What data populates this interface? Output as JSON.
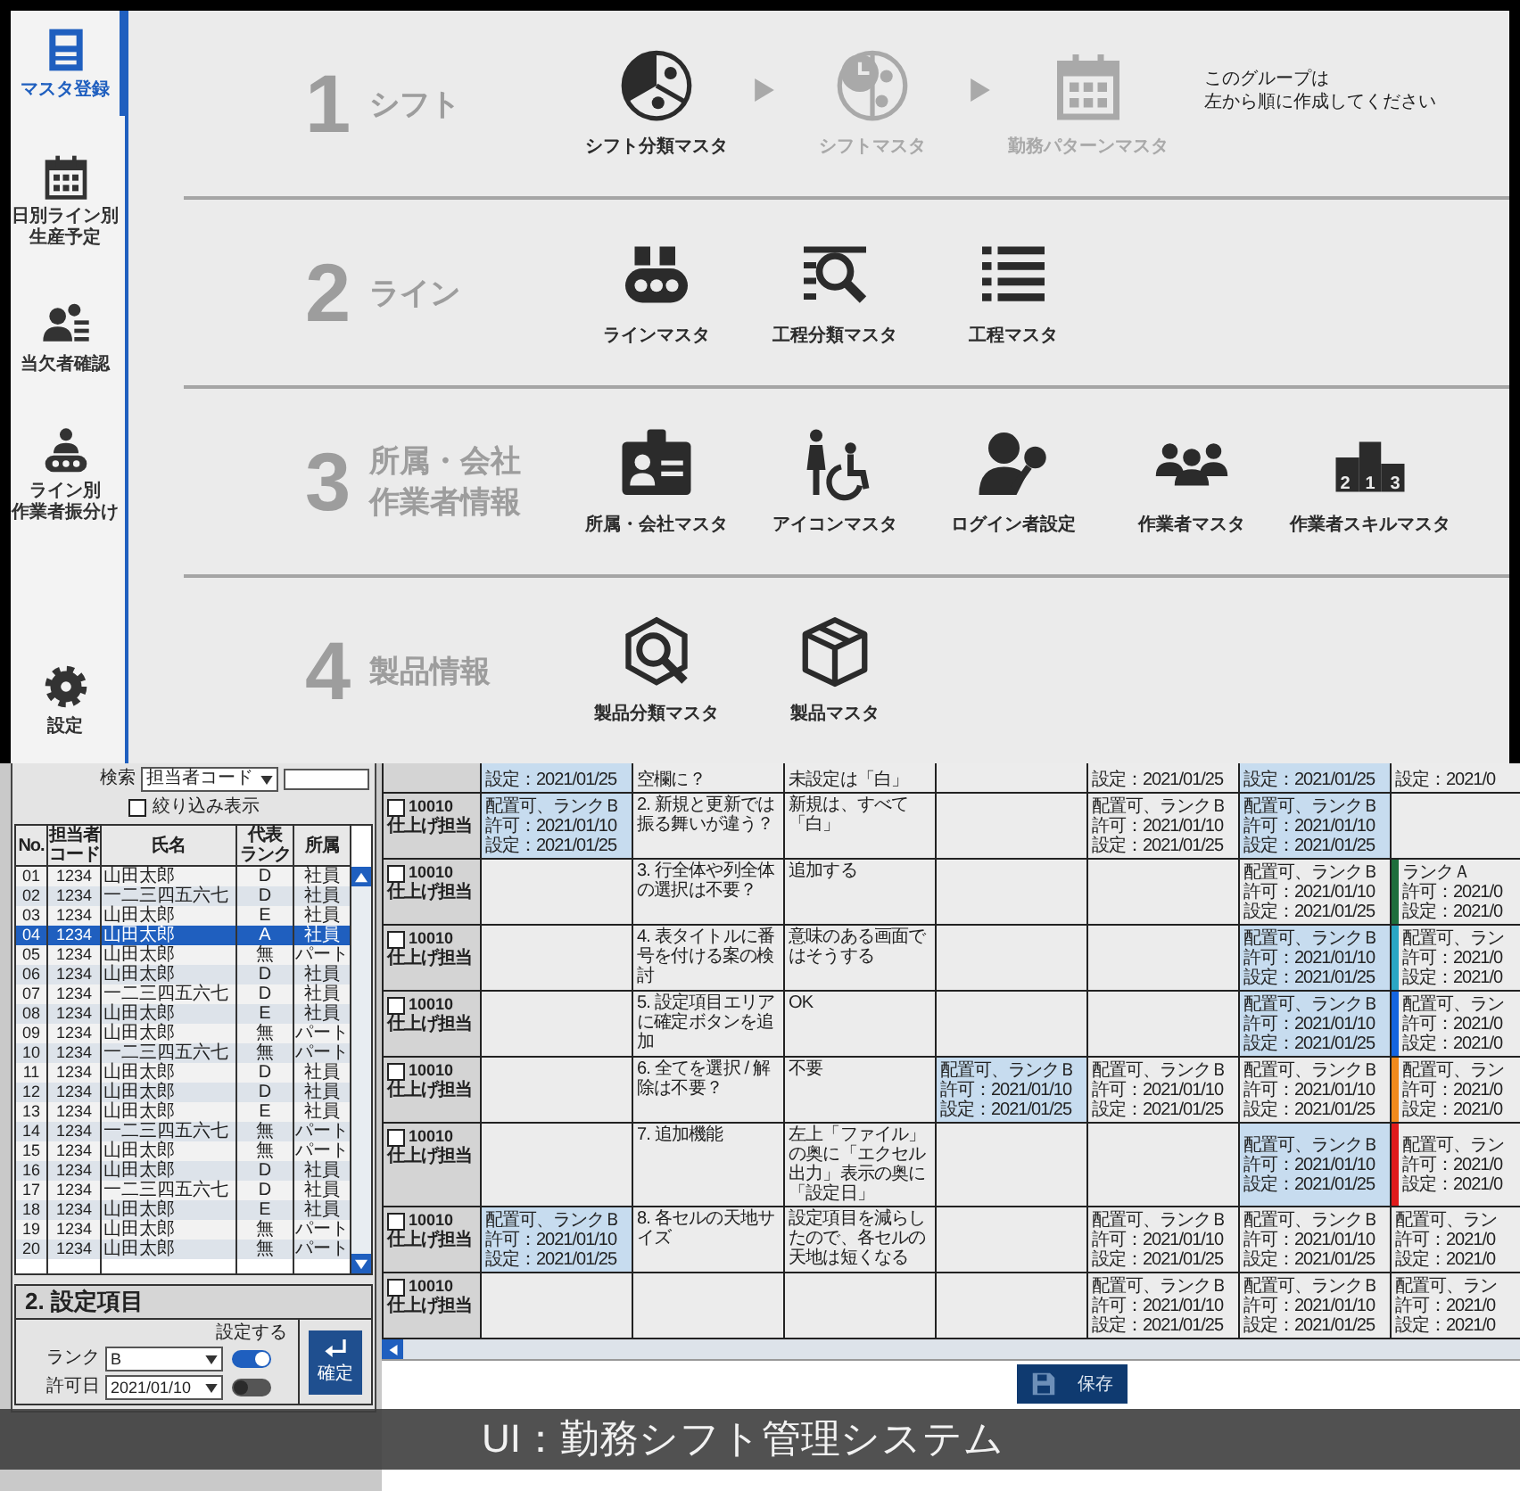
{
  "sidebar": {
    "items": [
      {
        "lines": [
          "マスタ登録"
        ],
        "selected": true
      },
      {
        "lines": [
          "日別ライン別",
          "生産予定"
        ],
        "selected": false
      },
      {
        "lines": [
          "当欠者確認"
        ],
        "selected": false
      },
      {
        "lines": [
          "ライン別",
          "作業者振分け"
        ],
        "selected": false
      },
      {
        "lines": [
          "設定"
        ],
        "selected": false
      }
    ]
  },
  "sections": [
    {
      "number": "1",
      "title": [
        "シフト"
      ],
      "items": [
        {
          "kind": "item",
          "label": "シフト分類マスタ",
          "disabled": false
        },
        {
          "kind": "arrow"
        },
        {
          "kind": "item",
          "label": "シフトマスタ",
          "disabled": true
        },
        {
          "kind": "arrow"
        },
        {
          "kind": "item",
          "label": "勤務パターンマスタ",
          "disabled": true
        }
      ],
      "note": [
        "このグループは",
        "左から順に作成してください"
      ]
    },
    {
      "number": "2",
      "title": [
        "ライン"
      ],
      "items": [
        {
          "kind": "item",
          "label": "ラインマスタ",
          "disabled": false
        },
        {
          "kind": "item",
          "label": "工程分類マスタ",
          "disabled": false
        },
        {
          "kind": "item",
          "label": "工程マスタ",
          "disabled": false
        }
      ]
    },
    {
      "number": "3",
      "title": [
        "所属・会社",
        "作業者情報"
      ],
      "items": [
        {
          "kind": "item",
          "label": "所属・会社マスタ",
          "disabled": false
        },
        {
          "kind": "item",
          "label": "アイコンマスタ",
          "disabled": false
        },
        {
          "kind": "item",
          "label": "ログイン者設定",
          "disabled": false
        },
        {
          "kind": "item",
          "label": "作業者マスタ",
          "disabled": false
        },
        {
          "kind": "item",
          "label": "作業者スキルマスタ",
          "icon_text": [
            "2",
            "1",
            "3"
          ],
          "disabled": false
        }
      ]
    },
    {
      "number": "4",
      "title": [
        "製品情報"
      ],
      "items": [
        {
          "kind": "item",
          "label": "製品分類マスタ",
          "disabled": false
        },
        {
          "kind": "item",
          "label": "製品マスタ",
          "disabled": false
        }
      ]
    }
  ],
  "staff_panel": {
    "search": {
      "label": "検索",
      "select": "担当者コード"
    },
    "filter": {
      "label": "絞り込み表示",
      "checked": false
    },
    "columns": [
      [
        "No."
      ],
      [
        "担当者",
        "コード"
      ],
      [
        "氏名"
      ],
      [
        "代表",
        "ランク"
      ],
      [
        "所属"
      ]
    ],
    "rows": [
      {
        "no": "01",
        "code": "1234",
        "name": "山田太郎",
        "rank": "D",
        "dept": "社員",
        "selected": false
      },
      {
        "no": "02",
        "code": "1234",
        "name": "一二三四五六七",
        "rank": "D",
        "dept": "社員",
        "selected": false
      },
      {
        "no": "03",
        "code": "1234",
        "name": "山田太郎",
        "rank": "E",
        "dept": "社員",
        "selected": false
      },
      {
        "no": "04",
        "code": "1234",
        "name": "山田太郎",
        "rank": "A",
        "dept": "社員",
        "selected": true
      },
      {
        "no": "05",
        "code": "1234",
        "name": "山田太郎",
        "rank": "無",
        "dept": "パート",
        "selected": false
      },
      {
        "no": "06",
        "code": "1234",
        "name": "山田太郎",
        "rank": "D",
        "dept": "社員",
        "selected": false
      },
      {
        "no": "07",
        "code": "1234",
        "name": "一二三四五六七",
        "rank": "D",
        "dept": "社員",
        "selected": false
      },
      {
        "no": "08",
        "code": "1234",
        "name": "山田太郎",
        "rank": "E",
        "dept": "社員",
        "selected": false
      },
      {
        "no": "09",
        "code": "1234",
        "name": "山田太郎",
        "rank": "無",
        "dept": "パート",
        "selected": false
      },
      {
        "no": "10",
        "code": "1234",
        "name": "一二三四五六七",
        "rank": "無",
        "dept": "パート",
        "selected": false
      },
      {
        "no": "11",
        "code": "1234",
        "name": "山田太郎",
        "rank": "D",
        "dept": "社員",
        "selected": false
      },
      {
        "no": "12",
        "code": "1234",
        "name": "山田太郎",
        "rank": "D",
        "dept": "社員",
        "selected": false
      },
      {
        "no": "13",
        "code": "1234",
        "name": "山田太郎",
        "rank": "E",
        "dept": "社員",
        "selected": false
      },
      {
        "no": "14",
        "code": "1234",
        "name": "一二三四五六七",
        "rank": "無",
        "dept": "パート",
        "selected": false
      },
      {
        "no": "15",
        "code": "1234",
        "name": "山田太郎",
        "rank": "無",
        "dept": "パート",
        "selected": false
      },
      {
        "no": "16",
        "code": "1234",
        "name": "山田太郎",
        "rank": "D",
        "dept": "社員",
        "selected": false
      },
      {
        "no": "17",
        "code": "1234",
        "name": "一二三四五六七",
        "rank": "D",
        "dept": "社員",
        "selected": false
      },
      {
        "no": "18",
        "code": "1234",
        "name": "山田太郎",
        "rank": "E",
        "dept": "社員",
        "selected": false
      },
      {
        "no": "19",
        "code": "1234",
        "name": "山田太郎",
        "rank": "無",
        "dept": "パート",
        "selected": false
      },
      {
        "no": "20",
        "code": "1234",
        "name": "山田太郎",
        "rank": "無",
        "dept": "パート",
        "selected": false
      }
    ],
    "settings": {
      "title": "2. 設定項目",
      "toggle_label": "設定する",
      "fields": [
        {
          "label": "ランク",
          "value": "B",
          "on": true
        },
        {
          "label": "許可日",
          "value": "2021/01/10",
          "on": false
        }
      ],
      "button": "確定"
    }
  },
  "grid": {
    "rows": [
      {
        "cells": [
          {
            "kind": "assignment",
            "lines": [
              "設定：2021/01/25"
            ],
            "highlighted": true
          },
          {
            "kind": "note",
            "text": "空欄に？"
          },
          {
            "kind": "note",
            "text": "未設定は「白」"
          },
          {
            "kind": "empty"
          },
          {
            "kind": "assignment",
            "lines": [
              "設定：2021/01/25"
            ],
            "highlighted": false
          },
          {
            "kind": "assignment",
            "lines": [
              "設定：2021/01/25"
            ],
            "highlighted": true
          },
          {
            "kind": "assignment",
            "lines": [
              "設定：2021/0"
            ],
            "highlighted": false
          }
        ]
      },
      {
        "header": {
          "code": "10010",
          "role": "仕上げ担当",
          "checked": false
        },
        "cells": [
          {
            "kind": "assignment",
            "lines": [
              "配置可、ランクＢ",
              "許可：2021/01/10",
              "設定：2021/01/25"
            ],
            "highlighted": true
          },
          {
            "kind": "note",
            "text": "2. 新規と更新では振る舞いが違う？"
          },
          {
            "kind": "note",
            "text": "新規は、すべて「白」"
          },
          {
            "kind": "empty"
          },
          {
            "kind": "assignment",
            "lines": [
              "配置可、ランクＢ",
              "許可：2021/01/10",
              "設定：2021/01/25"
            ],
            "highlighted": false
          },
          {
            "kind": "assignment",
            "lines": [
              "配置可、ランクＢ",
              "許可：2021/01/10",
              "設定：2021/01/25"
            ],
            "highlighted": true
          },
          {
            "kind": "empty"
          }
        ]
      },
      {
        "header": {
          "code": "10010",
          "role": "仕上げ担当",
          "checked": false
        },
        "cells": [
          {
            "kind": "empty"
          },
          {
            "kind": "note",
            "text": "3. 行全体や列全体の選択は不要？"
          },
          {
            "kind": "note",
            "text": "追加する"
          },
          {
            "kind": "empty"
          },
          {
            "kind": "empty"
          },
          {
            "kind": "assignment",
            "lines": [
              "配置可、ランクＢ",
              "許可：2021/01/10",
              "設定：2021/01/25"
            ],
            "highlighted": false
          },
          {
            "kind": "assignment",
            "lines": [
              "ランクＡ",
              "許可：2021/0",
              "設定：2021/0"
            ],
            "highlighted": false,
            "color": "#1e6e3c"
          }
        ]
      },
      {
        "header": {
          "code": "10010",
          "role": "仕上げ担当",
          "checked": false
        },
        "cells": [
          {
            "kind": "empty"
          },
          {
            "kind": "note",
            "text": "4. 表タイトルに番号を付ける案の検討"
          },
          {
            "kind": "note",
            "text": "意味のある画面ではそうする"
          },
          {
            "kind": "empty"
          },
          {
            "kind": "empty"
          },
          {
            "kind": "assignment",
            "lines": [
              "配置可、ランクＢ",
              "許可：2021/01/10",
              "設定：2021/01/25"
            ],
            "highlighted": true
          },
          {
            "kind": "assignment",
            "lines": [
              "配置可、ラン",
              "許可：2021/0",
              "設定：2021/0"
            ],
            "highlighted": false,
            "color": "#2aa6c4"
          }
        ]
      },
      {
        "header": {
          "code": "10010",
          "role": "仕上げ担当",
          "checked": false
        },
        "cells": [
          {
            "kind": "empty"
          },
          {
            "kind": "note",
            "text": "5. 設定項目エリアに確定ボタンを追加"
          },
          {
            "kind": "note",
            "text": "OK"
          },
          {
            "kind": "empty"
          },
          {
            "kind": "empty"
          },
          {
            "kind": "assignment",
            "lines": [
              "配置可、ランクＢ",
              "許可：2021/01/10",
              "設定：2021/01/25"
            ],
            "highlighted": true
          },
          {
            "kind": "assignment",
            "lines": [
              "配置可、ラン",
              "許可：2021/0",
              "設定：2021/0"
            ],
            "highlighted": false,
            "color": "#1565e0"
          }
        ]
      },
      {
        "header": {
          "code": "10010",
          "role": "仕上げ担当",
          "checked": false
        },
        "cells": [
          {
            "kind": "empty"
          },
          {
            "kind": "note",
            "text": "6. 全てを選択 / 解除は不要？"
          },
          {
            "kind": "note",
            "text": "不要"
          },
          {
            "kind": "assignment",
            "lines": [
              "配置可、ランクＢ",
              "許可：2021/01/10",
              "設定：2021/01/25"
            ],
            "highlighted": true
          },
          {
            "kind": "assignment",
            "lines": [
              "配置可、ランクＢ",
              "許可：2021/01/10",
              "設定：2021/01/25"
            ],
            "highlighted": false
          },
          {
            "kind": "assignment",
            "lines": [
              "配置可、ランクＢ",
              "許可：2021/01/10",
              "設定：2021/01/25"
            ],
            "highlighted": false
          },
          {
            "kind": "assignment",
            "lines": [
              "配置可、ラン",
              "許可：2021/0",
              "設定：2021/0"
            ],
            "highlighted": false,
            "color": "#f08a1c"
          }
        ]
      },
      {
        "header": {
          "code": "10010",
          "role": "仕上げ担当",
          "checked": false
        },
        "cells": [
          {
            "kind": "empty"
          },
          {
            "kind": "note",
            "text": "7. 追加機能"
          },
          {
            "kind": "note",
            "text": "左上「ファイル」の奥に「エクセル出力」表示の奥に「設定日」"
          },
          {
            "kind": "empty"
          },
          {
            "kind": "empty"
          },
          {
            "kind": "assignment",
            "lines": [
              "配置可、ランクＢ",
              "許可：2021/01/10",
              "設定：2021/01/25"
            ],
            "highlighted": true
          },
          {
            "kind": "assignment",
            "lines": [
              "配置可、ラン",
              "許可：2021/0",
              "設定：2021/0"
            ],
            "highlighted": false,
            "color": "#e01b1b"
          }
        ]
      },
      {
        "header": {
          "code": "10010",
          "role": "仕上げ担当",
          "checked": false
        },
        "cells": [
          {
            "kind": "assignment",
            "lines": [
              "配置可、ランクＢ",
              "許可：2021/01/10",
              "設定：2021/01/25"
            ],
            "highlighted": true
          },
          {
            "kind": "note",
            "text": "8. 各セルの天地サイズ"
          },
          {
            "kind": "note",
            "text": "設定項目を減らしたので、各セルの天地は短くなる"
          },
          {
            "kind": "empty"
          },
          {
            "kind": "assignment",
            "lines": [
              "配置可、ランクＢ",
              "許可：2021/01/10",
              "設定：2021/01/25"
            ],
            "highlighted": false
          },
          {
            "kind": "assignment",
            "lines": [
              "配置可、ランクＢ",
              "許可：2021/01/10",
              "設定：2021/01/25"
            ],
            "highlighted": false
          },
          {
            "kind": "assignment",
            "lines": [
              "配置可、ラン",
              "許可：2021/0",
              "設定：2021/0"
            ],
            "highlighted": false
          }
        ]
      },
      {
        "header": {
          "code": "10010",
          "role": "仕上げ担当",
          "checked": false
        },
        "cells": [
          {
            "kind": "empty"
          },
          {
            "kind": "empty"
          },
          {
            "kind": "empty"
          },
          {
            "kind": "empty"
          },
          {
            "kind": "assignment",
            "lines": [
              "配置可、ランクＢ",
              "許可：2021/01/10",
              "設定：2021/01/25"
            ],
            "highlighted": false
          },
          {
            "kind": "assignment",
            "lines": [
              "配置可、ランクＢ",
              "許可：2021/01/10",
              "設定：2021/01/25"
            ],
            "highlighted": false
          },
          {
            "kind": "assignment",
            "lines": [
              "配置可、ラン",
              "許可：2021/0",
              "設定：2021/0"
            ],
            "highlighted": false
          }
        ]
      }
    ]
  },
  "save_button": "保存",
  "caption": "UI：勤務シフト管理システム"
}
